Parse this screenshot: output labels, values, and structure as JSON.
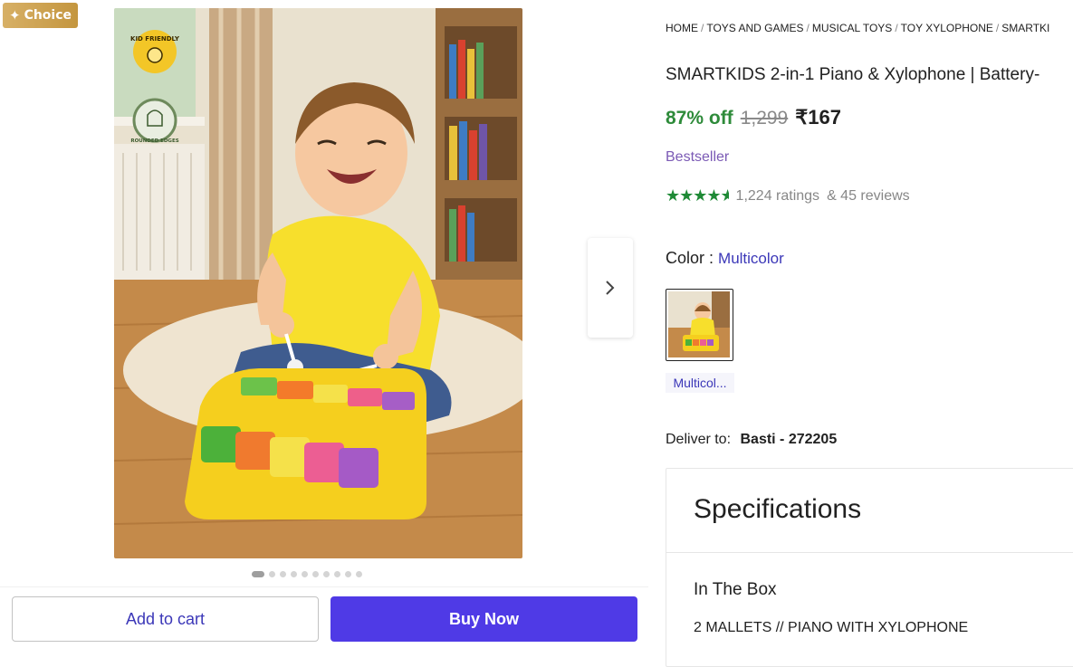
{
  "badge": {
    "label": "Choice",
    "icon": "sparkle-icon"
  },
  "gallery": {
    "image_labels": [
      "KID FRIENDLY",
      "ROUNDED EDGES"
    ],
    "dots_count": 10,
    "active_dot": 0
  },
  "actions": {
    "add_to_cart": "Add to cart",
    "buy_now": "Buy Now"
  },
  "breadcrumb": [
    "HOME",
    "TOYS AND GAMES",
    "MUSICAL TOYS",
    "TOY XYLOPHONE",
    "SMARTKI"
  ],
  "product": {
    "title": "SMARTKIDS 2-in-1 Piano & Xylophone | Battery-",
    "discount": "87% off",
    "mrp": "1,299",
    "price": "₹167",
    "bestseller": "Bestseller",
    "rating_stars": 4.5,
    "ratings": "1,224 ratings",
    "reviews": "& 45 reviews"
  },
  "color": {
    "label": "Color :",
    "value": "Multicolor",
    "swatch_label": "Multicol..."
  },
  "delivery": {
    "label": "Deliver to:",
    "location": "Basti - 272205"
  },
  "specifications": {
    "title": "Specifications",
    "section": "In The Box",
    "value": "2 MALLETS // PIANO WITH XYLOPHONE"
  },
  "colors": {
    "accent": "#4f3ae6",
    "discount_green": "#2e8b3a",
    "star_green": "#1f8a36",
    "link": "#3b37b8"
  }
}
